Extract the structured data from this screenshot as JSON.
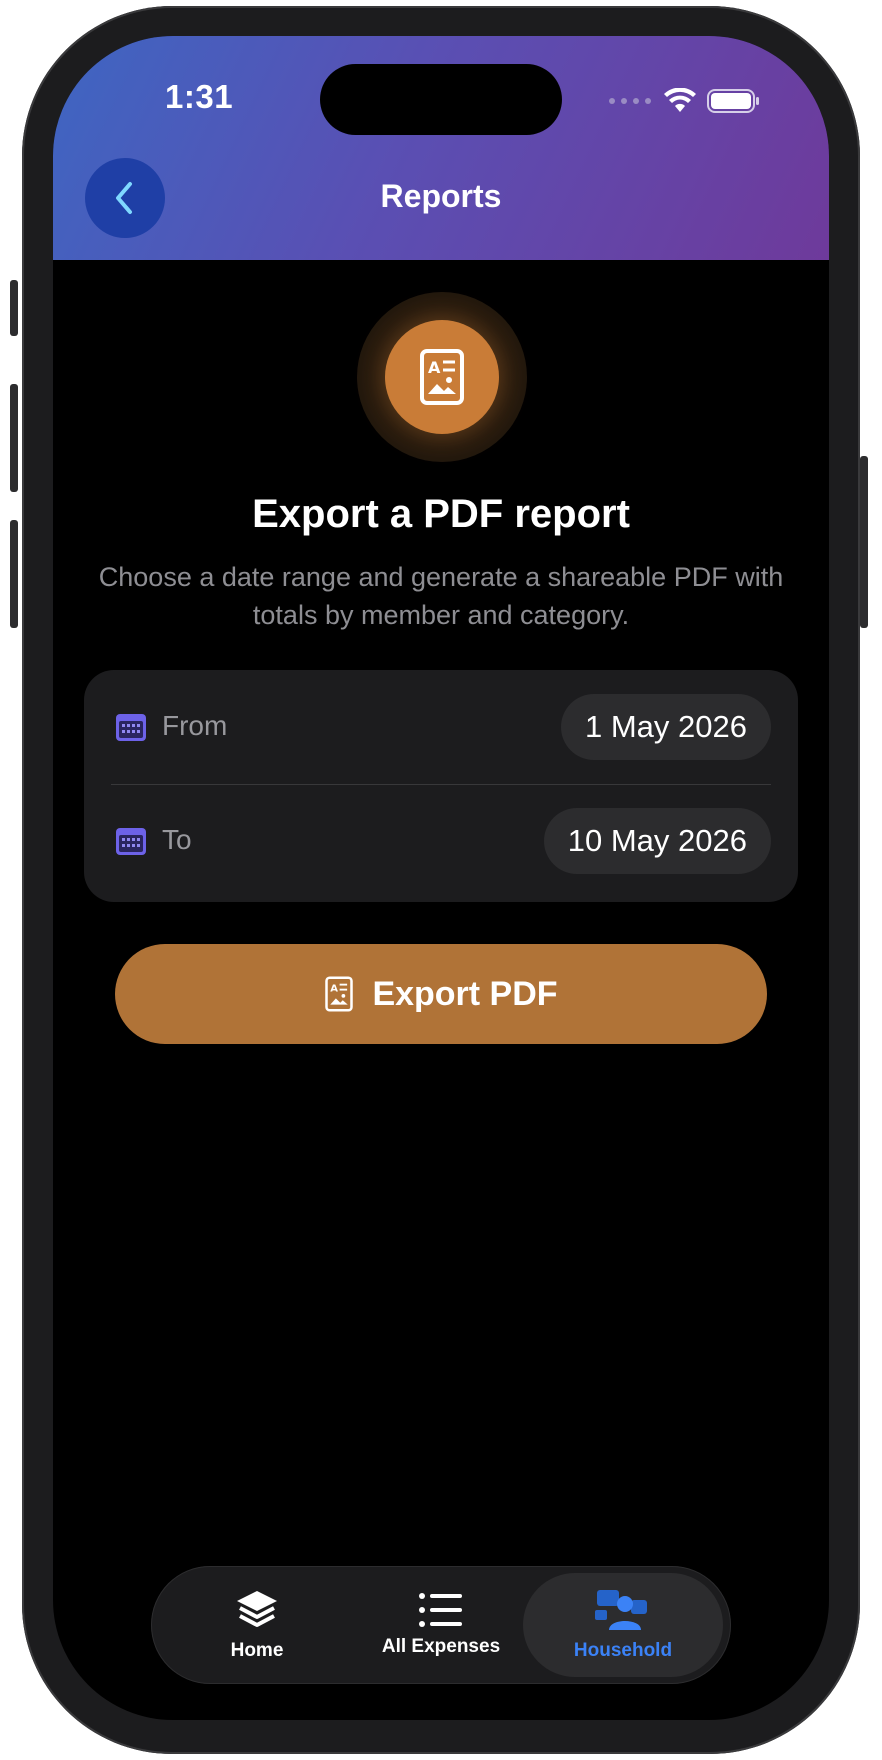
{
  "status_bar": {
    "time": "1:31"
  },
  "header": {
    "title": "Reports",
    "back_icon": "chevron-left-icon"
  },
  "hero": {
    "icon": "report-document-icon",
    "title": "Export a PDF report",
    "subtitle": "Choose a date range and generate a shareable PDF with totals by member and category."
  },
  "date_range": {
    "from": {
      "label": "From",
      "value": "1 May 2026",
      "icon": "calendar-icon"
    },
    "to": {
      "label": "To",
      "value": "10 May 2026",
      "icon": "calendar-icon"
    }
  },
  "export_button": {
    "label": "Export PDF",
    "icon": "report-document-icon"
  },
  "tab_bar": {
    "items": [
      {
        "label": "Home",
        "icon": "layers-icon",
        "active": false
      },
      {
        "label": "All Expenses",
        "icon": "list-icon",
        "active": false
      },
      {
        "label": "Household",
        "icon": "people-icon",
        "active": true
      }
    ]
  },
  "colors": {
    "accent_orange": "#c97c37",
    "button_orange": "#b07337",
    "active_tab_blue": "#3b82f6",
    "calendar_purple": "#6d62e8",
    "header_gradient_start": "#3e66c2",
    "header_gradient_end": "#6e3a9b"
  }
}
